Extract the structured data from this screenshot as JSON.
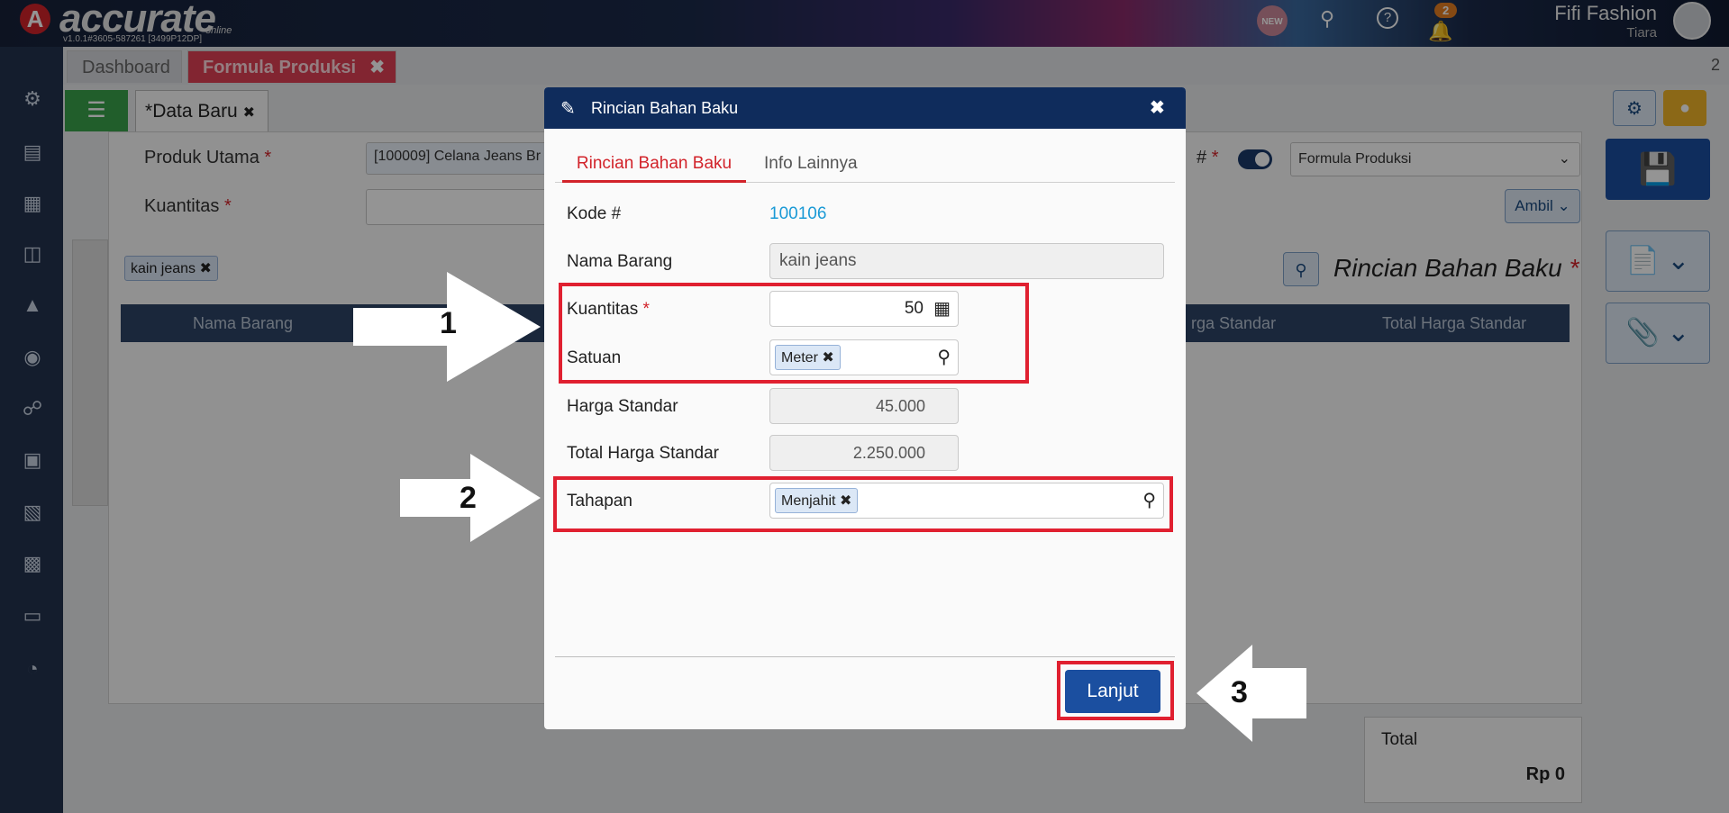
{
  "app": {
    "brand": "accurate",
    "brand_sub": "online",
    "version": "v1.0.1#3605-587261 [3499P12DP]",
    "notif_new": "NEW",
    "notif_count": "2",
    "company": "Fifi Fashion",
    "user": "Tiara"
  },
  "tabs": {
    "dashboard": "Dashboard",
    "formula": "Formula Produksi",
    "count": "2"
  },
  "form": {
    "subtab": "Data Baru",
    "produk_utama_label": "Produk Utama",
    "produk_utama_value": "[100009] Celana Jeans Br",
    "kuantitas_label": "Kuantitas",
    "number_label": "#",
    "formula_select": "Formula Produksi",
    "ambil": "Ambil",
    "filter_chip": "kain jeans",
    "section_title": "Rincian Bahan Baku",
    "col_nama": "Nama Barang",
    "col_harga": "rga Standar",
    "col_total": "Total Harga Standar",
    "total_label": "Total",
    "total_value": "Rp 0"
  },
  "modal": {
    "title": "Rincian Bahan Baku",
    "tab_active": "Rincian Bahan Baku",
    "tab_other": "Info Lainnya",
    "kode_label": "Kode #",
    "kode_value": "100106",
    "nama_label": "Nama Barang",
    "nama_value": "kain jeans",
    "kuantitas_label": "Kuantitas",
    "kuantitas_value": "50",
    "satuan_label": "Satuan",
    "satuan_chip": "Meter",
    "harga_label": "Harga Standar",
    "harga_value": "45.000",
    "total_label": "Total Harga Standar",
    "total_value": "2.250.000",
    "tahapan_label": "Tahapan",
    "tahapan_chip": "Menjahit",
    "button": "Lanjut"
  },
  "annotations": [
    "1",
    "2",
    "3"
  ],
  "colors": {
    "accent_red": "#e02030",
    "primary_blue": "#1b4fa0",
    "header_navy": "#0f2c5c",
    "link_blue": "#1a9ad6"
  }
}
